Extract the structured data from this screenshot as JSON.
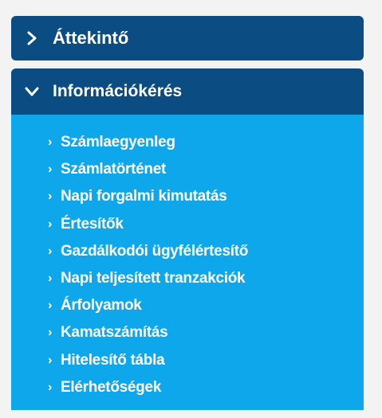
{
  "menu": {
    "section1": {
      "label": "Áttekintő",
      "icon": "chevron-right-icon",
      "expanded": false
    },
    "section2": {
      "label": "Információkérés",
      "icon": "chevron-down-icon",
      "expanded": true,
      "items": [
        {
          "label": "Számlaegyenleg"
        },
        {
          "label": "Számlatörténet"
        },
        {
          "label": "Napi forgalmi kimutatás"
        },
        {
          "label": "Értesítők"
        },
        {
          "label": "Gazdálkodói ügyfélértesítő"
        },
        {
          "label": "Napi teljesített tranzakciók"
        },
        {
          "label": "Árfolyamok"
        },
        {
          "label": "Kamatszámítás"
        },
        {
          "label": "Hitelesítő tábla"
        },
        {
          "label": "Elérhetőségek"
        }
      ]
    }
  },
  "colors": {
    "header_bg": "#0b4d82",
    "submenu_bg": "#0ea7ec",
    "panel_bg": "#f3f3f3",
    "text": "#ffffff"
  }
}
